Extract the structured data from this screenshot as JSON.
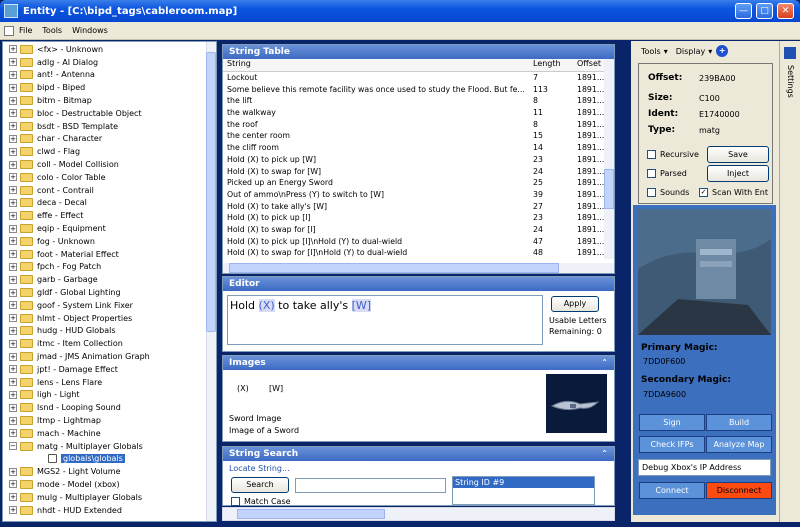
{
  "window": {
    "title": "Entity - [C:\\bipd_tags\\cableroom.map]"
  },
  "menu": [
    "File",
    "Tools",
    "Windows"
  ],
  "tree": {
    "items": [
      "<fx> - Unknown",
      "adlg - AI Dialog",
      "ant! - Antenna",
      "bipd - Biped",
      "bitm - Bitmap",
      "bloc - Destructable Object",
      "bsdt - BSD Template",
      "char - Character",
      "clwd - Flag",
      "coll - Model Collision",
      "colo - Color Table",
      "cont - Contrail",
      "deca - Decal",
      "effe - Effect",
      "eqip - Equipment",
      "fog - Unknown",
      "foot - Material Effect",
      "fpch - Fog Patch",
      "garb - Garbage",
      "gldf - Global Lighting",
      "goof - System Link Fixer",
      "hlmt - Object Properties",
      "hudg - HUD Globals",
      "itmc - Item Collection",
      "jmad - JMS Animation Graph",
      "jpt! - Damage Effect",
      "lens - Lens Flare",
      "ligh - Light",
      "lsnd - Looping Sound",
      "ltmp - Lightmap",
      "mach - Machine",
      "matg - Multiplayer Globals"
    ],
    "selected": "globals\\globals",
    "after": [
      "MGS2 - Light Volume",
      "mode - Model (xbox)",
      "mulg - Multiplayer Globals",
      "nhdt - HUD Extended"
    ]
  },
  "string_table": {
    "title": "String Table",
    "columns": [
      "String",
      "Length",
      "Offset"
    ],
    "rows": [
      [
        "Lockout",
        "7",
        "1891..."
      ],
      [
        "Some believe this remote facility was once used to study the Flood. But fe...",
        "113",
        "1891..."
      ],
      [
        "the lift",
        "8",
        "1891..."
      ],
      [
        "the walkway",
        "11",
        "1891..."
      ],
      [
        "the roof",
        "8",
        "1891..."
      ],
      [
        "the center room",
        "15",
        "1891..."
      ],
      [
        "the cliff room",
        "14",
        "1891..."
      ],
      [
        "Hold (X) to pick up [W]",
        "23",
        "1891..."
      ],
      [
        "Hold (X) to swap for [W]",
        "24",
        "1891..."
      ],
      [
        "Picked up an Energy Sword",
        "25",
        "1891..."
      ],
      [
        "Out of ammo\\nPress (Y) to switch to [W]",
        "39",
        "1891..."
      ],
      [
        "Hold (X) to take ally's [W]",
        "27",
        "1891..."
      ],
      [
        "Hold (X) to pick up [I]",
        "23",
        "1891..."
      ],
      [
        "Hold (X) to swap for [I]",
        "24",
        "1891..."
      ],
      [
        "Hold (X) to pick up [I]\\nHold (Y) to dual-wield",
        "47",
        "1891..."
      ],
      [
        "Hold (X) to swap for [I]\\nHold (Y) to dual-wield",
        "48",
        "1891..."
      ]
    ]
  },
  "editor": {
    "title": "Editor",
    "text_parts": [
      "Hold ",
      "(X)",
      " to take ally's ",
      "[W]"
    ],
    "apply": "Apply",
    "usable": "Usable Letters",
    "remaining": "Remaining: 0"
  },
  "images": {
    "title": "Images",
    "tokens": [
      "(X)",
      "[W]"
    ],
    "name": "Sword Image",
    "desc": "Image of a Sword"
  },
  "string_search": {
    "title": "String Search",
    "group": "Locate String...",
    "search": "Search",
    "match_case": "Match Case",
    "result": "String ID #9"
  },
  "right": {
    "tools": "Tools",
    "display": "Display",
    "offset_label": "Offset:",
    "offset": "239BA00",
    "size_label": "Size:",
    "size": "C100",
    "ident_label": "Ident:",
    "ident": "E1740000",
    "type_label": "Type:",
    "type": "matg",
    "recursive": "Recursive",
    "parsed": "Parsed",
    "sounds": "Sounds",
    "scan": "Scan With Ent",
    "save": "Save",
    "inject": "Inject",
    "primary_label": "Primary Magic:",
    "primary": "7DD0F600",
    "secondary_label": "Secondary Magic:",
    "secondary": "7DDA9600",
    "sign": "Sign",
    "build": "Build",
    "check": "Check IFPs",
    "analyze": "Analyze Map",
    "debug": "Debug Xbox's IP Address",
    "connect": "Connect",
    "disconnect": "Disconnect",
    "settings": "Settings"
  }
}
